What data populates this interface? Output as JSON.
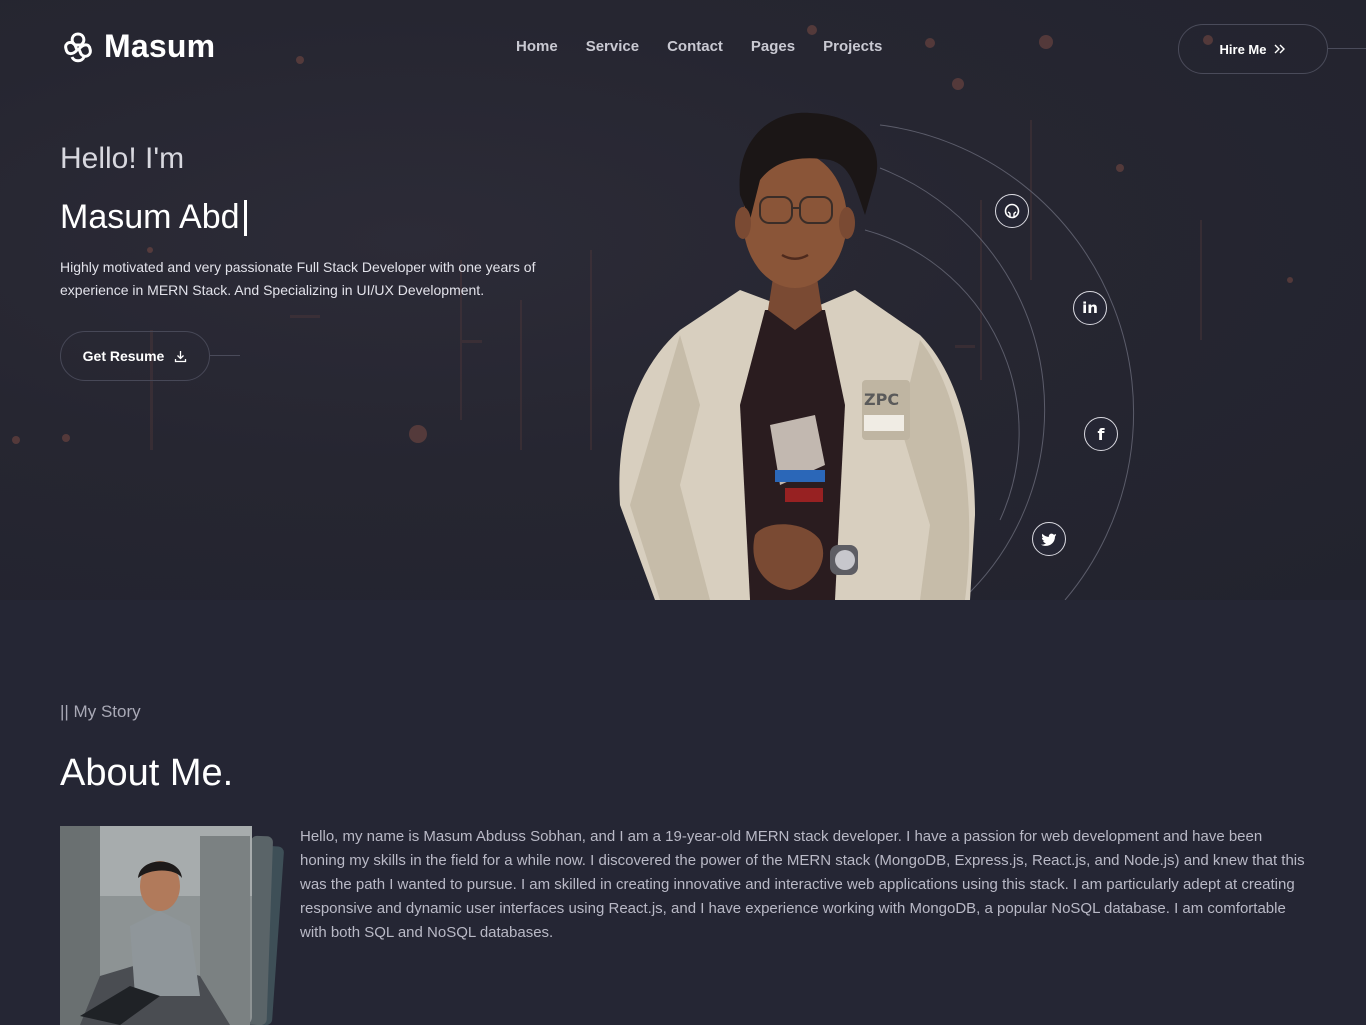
{
  "header": {
    "logo_text": "Masum",
    "logo_icon": "flower-knot-icon",
    "nav": [
      "Home",
      "Service",
      "Contact",
      "Pages",
      "Projects"
    ],
    "hire_label": "Hire Me",
    "hire_icon": "double-chevron-right-icon"
  },
  "hero": {
    "greeting": "Hello! I'm",
    "typed_name": "Masum Abd",
    "description": "Highly motivated and very passionate Full Stack Developer with one years of experience in MERN Stack. And Specializing in UI/UX Development.",
    "resume_label": "Get Resume",
    "resume_icon": "download-icon",
    "socials": [
      "github-icon",
      "linkedin-icon",
      "facebook-icon",
      "twitter-icon"
    ]
  },
  "about": {
    "tag": "|| My Story",
    "title": "About Me.",
    "text": "Hello, my name is Masum Abduss Sobhan, and I am a 19-year-old MERN stack developer. I have a passion for web development and have been honing my skills in the field for a while now. I discovered the power of the MERN stack (MongoDB, Express.js, React.js, and Node.js) and knew that this was the path I wanted to pursue. I am skilled in creating innovative and interactive web applications using this stack. I am particularly adept at creating responsive and dynamic user interfaces using React.js, and I have experience working with MongoDB, a popular NoSQL database. I am comfortable with both SQL and NoSQL databases."
  },
  "colors": {
    "page_bg": "#252634",
    "hero_bg": "#262631",
    "accent_dots": "#e0643e",
    "text_muted": "#b9b9c6"
  }
}
